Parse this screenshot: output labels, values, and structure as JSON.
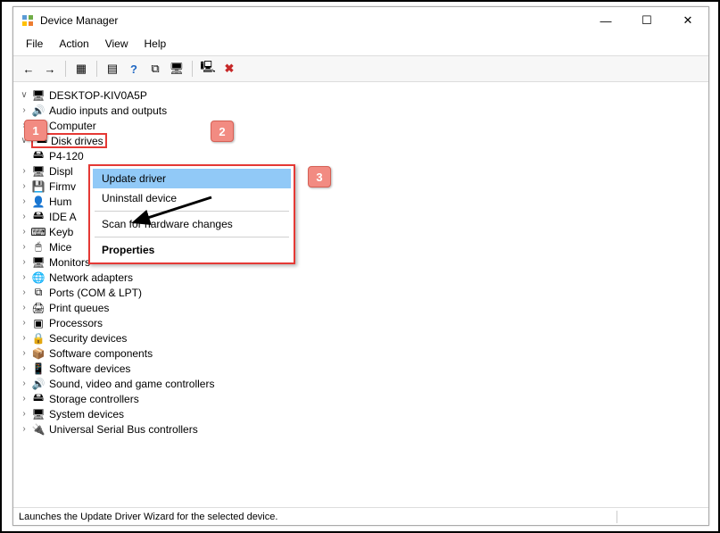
{
  "window": {
    "title": "Device Manager"
  },
  "menus": {
    "file": "File",
    "action": "Action",
    "view": "View",
    "help": "Help"
  },
  "toolbar_icons": {
    "back": "←",
    "forward": "→",
    "show_hidden": "▦",
    "devices_by_type": "▤",
    "help": "?",
    "calendar": "⧉",
    "monitor": "🖥",
    "scan": "🖳",
    "delete": "✖"
  },
  "tree": {
    "root": "DESKTOP-KIV0A5P",
    "items": [
      {
        "label": "Audio inputs and outputs",
        "exp": ">",
        "icon": "🔊"
      },
      {
        "label": "Computer",
        "exp": ">",
        "icon": "🖥"
      },
      {
        "label": "Disk drives",
        "exp": "v",
        "icon": "🖴",
        "highlight": true
      },
      {
        "label": "P4-120",
        "depth": 2,
        "icon": "🖴",
        "exp": ""
      },
      {
        "label": "Displ",
        "exp": ">",
        "icon": "🖥",
        "truncated": true
      },
      {
        "label": "Firmv",
        "exp": ">",
        "icon": "💾",
        "truncated": true
      },
      {
        "label": "Hum",
        "exp": ">",
        "icon": "👤",
        "truncated": true
      },
      {
        "label": "IDE A",
        "exp": ">",
        "icon": "🖴",
        "truncated": true
      },
      {
        "label": "Keyb",
        "exp": ">",
        "icon": "⌨",
        "truncated": true
      },
      {
        "label": "Mice",
        "exp": ">",
        "icon": "🖱",
        "truncated": true
      },
      {
        "label": "Monitors",
        "exp": ">",
        "icon": "🖥"
      },
      {
        "label": "Network adapters",
        "exp": ">",
        "icon": "🌐"
      },
      {
        "label": "Ports (COM & LPT)",
        "exp": ">",
        "icon": "⧉"
      },
      {
        "label": "Print queues",
        "exp": ">",
        "icon": "🖨"
      },
      {
        "label": "Processors",
        "exp": ">",
        "icon": "▣"
      },
      {
        "label": "Security devices",
        "exp": ">",
        "icon": "🔒"
      },
      {
        "label": "Software components",
        "exp": ">",
        "icon": "📦"
      },
      {
        "label": "Software devices",
        "exp": ">",
        "icon": "📱"
      },
      {
        "label": "Sound, video and game controllers",
        "exp": ">",
        "icon": "🔊"
      },
      {
        "label": "Storage controllers",
        "exp": ">",
        "icon": "🖴"
      },
      {
        "label": "System devices",
        "exp": ">",
        "icon": "🖥"
      },
      {
        "label": "Universal Serial Bus controllers",
        "exp": ">",
        "icon": "🔌"
      }
    ]
  },
  "context_menu": {
    "items": [
      {
        "label": "Update driver",
        "selected": true
      },
      {
        "label": "Uninstall device"
      },
      {
        "sep": true
      },
      {
        "label": "Scan for hardware changes"
      },
      {
        "sep": true
      },
      {
        "label": "Properties",
        "bold": true
      }
    ]
  },
  "callouts": {
    "c1": "1",
    "c2": "2",
    "c3": "3"
  },
  "status": {
    "text": "Launches the Update Driver Wizard for the selected device."
  }
}
